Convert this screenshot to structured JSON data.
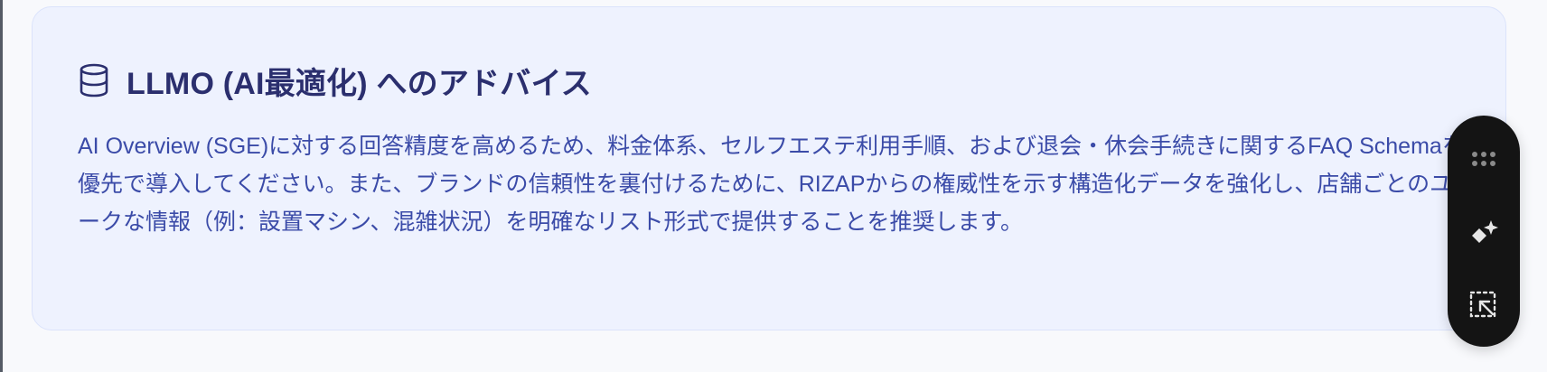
{
  "advice_card": {
    "icon": "database-icon",
    "title": "LLMO (AI最適化) へのアドバイス",
    "body": "AI Overview (SGE)に対する回答精度を高めるため、料金体系、セルフエステ利用手順、および退会・休会手続きに関するFAQ Schemaを最優先で導入してください。また、ブランドの信頼性を裏付けるために、RIZAPからの権威性を示す構造化データを強化し、店舗ごとのユニークな情報（例：設置マシン、混雑状況）を明確なリスト形式で提供することを推奨します。"
  },
  "floating_toolbar": {
    "items": [
      {
        "icon": "drag-handle-icon"
      },
      {
        "icon": "sparkle-icon"
      },
      {
        "icon": "select-area-icon"
      }
    ]
  },
  "colors": {
    "card_background": "#eef2fe",
    "card_border": "#dbe3fb",
    "title_text": "#2b2f6e",
    "body_text": "#3b4ba8",
    "toolbar_background": "#141414",
    "toolbar_icon": "#d6d6d6"
  }
}
